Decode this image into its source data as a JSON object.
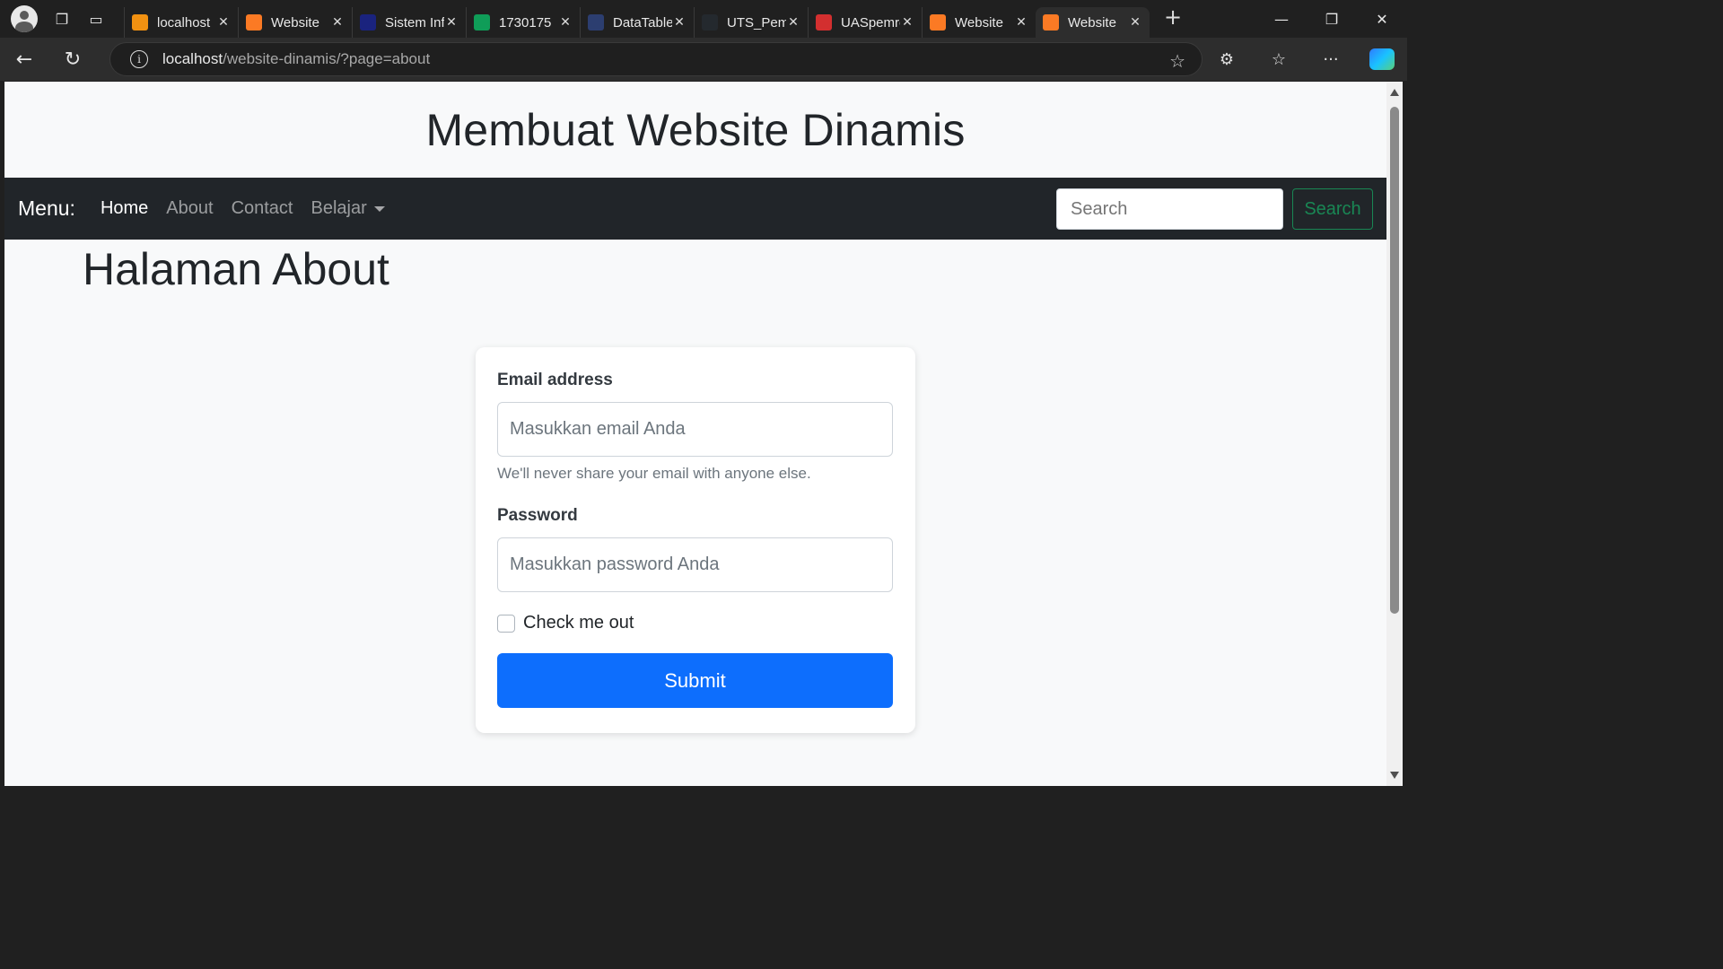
{
  "browser": {
    "tabs": [
      {
        "title": "localhost",
        "favicon": "phpmyadmin-icon",
        "color": "#f29111"
      },
      {
        "title": "Website",
        "favicon": "xampp-icon",
        "color": "#fb7a24"
      },
      {
        "title": "Sistem Informasi",
        "favicon": "app-icon",
        "color": "#1a237e"
      },
      {
        "title": "1730175",
        "favicon": "drive-icon",
        "color": "#0f9d58"
      },
      {
        "title": "DataTables",
        "favicon": "datatables-icon",
        "color": "#2c3e70"
      },
      {
        "title": "UTS_Pemrograman",
        "favicon": "github-icon",
        "color": "#24292e"
      },
      {
        "title": "UASpemrograman",
        "favicon": "pdf-icon",
        "color": "#d32f2f"
      },
      {
        "title": "Website",
        "favicon": "xampp-icon",
        "color": "#fb7a24"
      },
      {
        "title": "Website",
        "favicon": "xampp-icon",
        "color": "#fb7a24",
        "active": true
      }
    ],
    "url_host": "localhost",
    "url_path": "/website-dinamis/?page=about"
  },
  "site": {
    "title": "Membuat Website Dinamis"
  },
  "navbar": {
    "brand": "Menu:",
    "links": [
      "Home",
      "About",
      "Contact",
      "Belajar"
    ],
    "search_placeholder": "Search",
    "search_button": "Search"
  },
  "page": {
    "heading": "Halaman About"
  },
  "form": {
    "email_label": "Email address",
    "email_placeholder": "Masukkan email Anda",
    "email_help": "We'll never share your email with anyone else.",
    "password_label": "Password",
    "password_placeholder": "Masukkan password Anda",
    "checkbox_label": "Check me out",
    "submit_label": "Submit"
  },
  "colors": {
    "navbar_bg": "#212529",
    "primary": "#0d6efd",
    "success": "#198754"
  }
}
